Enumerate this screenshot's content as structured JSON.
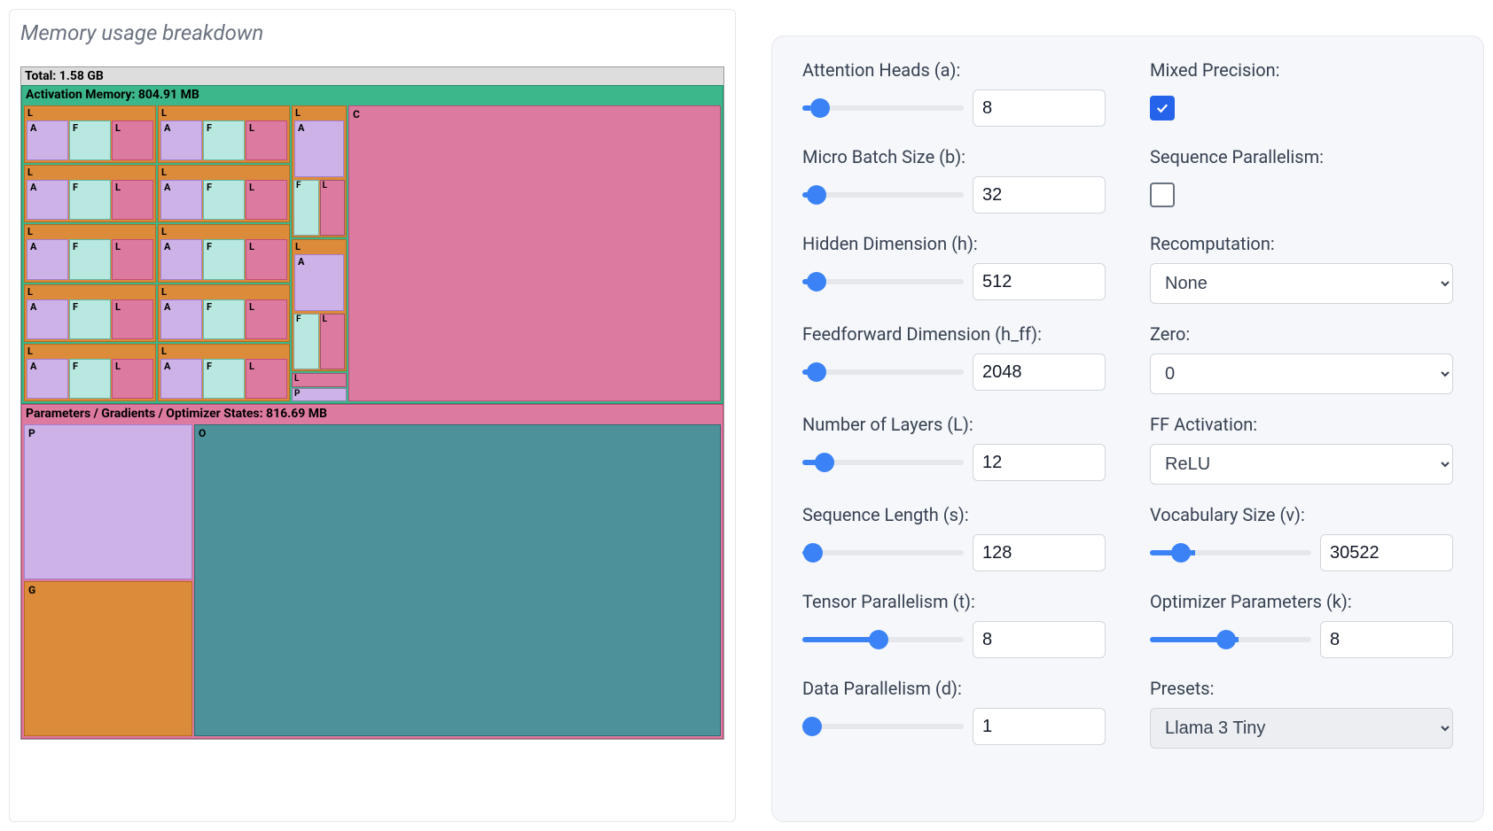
{
  "title": "Memory usage breakdown",
  "treemap": {
    "total_label": "Total: 1.58 GB",
    "activation_label": "Activation Memory: 804.91 MB",
    "layer_abbrev": "L",
    "attn_abbrev": "A",
    "ff_abbrev": "F",
    "ln_abbrev": "L",
    "cross_abbrev": "C",
    "proj_abbrev": "P",
    "pgo_label": "Parameters / Gradients / Optimizer States: 816.69 MB",
    "param_abbrev": "P",
    "grad_abbrev": "G",
    "opt_abbrev": "O"
  },
  "controls": {
    "attention_heads": {
      "label": "Attention Heads (a):",
      "value": "8"
    },
    "mixed_precision": {
      "label": "Mixed Precision:",
      "checked": true
    },
    "micro_batch": {
      "label": "Micro Batch Size (b):",
      "value": "32"
    },
    "seq_parallel": {
      "label": "Sequence Parallelism:",
      "checked": false
    },
    "hidden_dim": {
      "label": "Hidden Dimension (h):",
      "value": "512"
    },
    "recomputation": {
      "label": "Recomputation:",
      "value": "None"
    },
    "ff_dim": {
      "label": "Feedforward Dimension (h_ff):",
      "value": "2048"
    },
    "zero": {
      "label": "Zero:",
      "value": "0"
    },
    "num_layers": {
      "label": "Number of Layers (L):",
      "value": "12"
    },
    "ff_activation": {
      "label": "FF Activation:",
      "value": "ReLU"
    },
    "seq_len": {
      "label": "Sequence Length (s):",
      "value": "128"
    },
    "vocab_size": {
      "label": "Vocabulary Size (v):",
      "value": "30522"
    },
    "tensor_parallel": {
      "label": "Tensor Parallelism (t):",
      "value": "8"
    },
    "opt_params": {
      "label": "Optimizer Parameters (k):",
      "value": "8"
    },
    "data_parallel": {
      "label": "Data Parallelism (d):",
      "value": "1"
    },
    "presets": {
      "label": "Presets:",
      "value": "Llama 3 Tiny"
    }
  },
  "chart_data": {
    "type": "treemap",
    "unit": "MB",
    "total_gb": 1.58,
    "children": [
      {
        "name": "Activation Memory",
        "size_mb": 804.91,
        "color": "#3cb68b",
        "children": [
          {
            "name": "Layers",
            "count": 12,
            "color": "#db8b3a",
            "per_layer_children": [
              "A",
              "F",
              "L"
            ]
          },
          {
            "name": "C",
            "color": "#dd7aa0"
          },
          {
            "name": "P",
            "color": "#cdb2e8"
          }
        ]
      },
      {
        "name": "Parameters / Gradients / Optimizer States",
        "size_mb": 816.69,
        "color": "#dd7aa0",
        "children": [
          {
            "name": "P",
            "color": "#cdb2e8"
          },
          {
            "name": "G",
            "color": "#db8b3a"
          },
          {
            "name": "O",
            "color": "#4d929a"
          }
        ]
      }
    ]
  }
}
